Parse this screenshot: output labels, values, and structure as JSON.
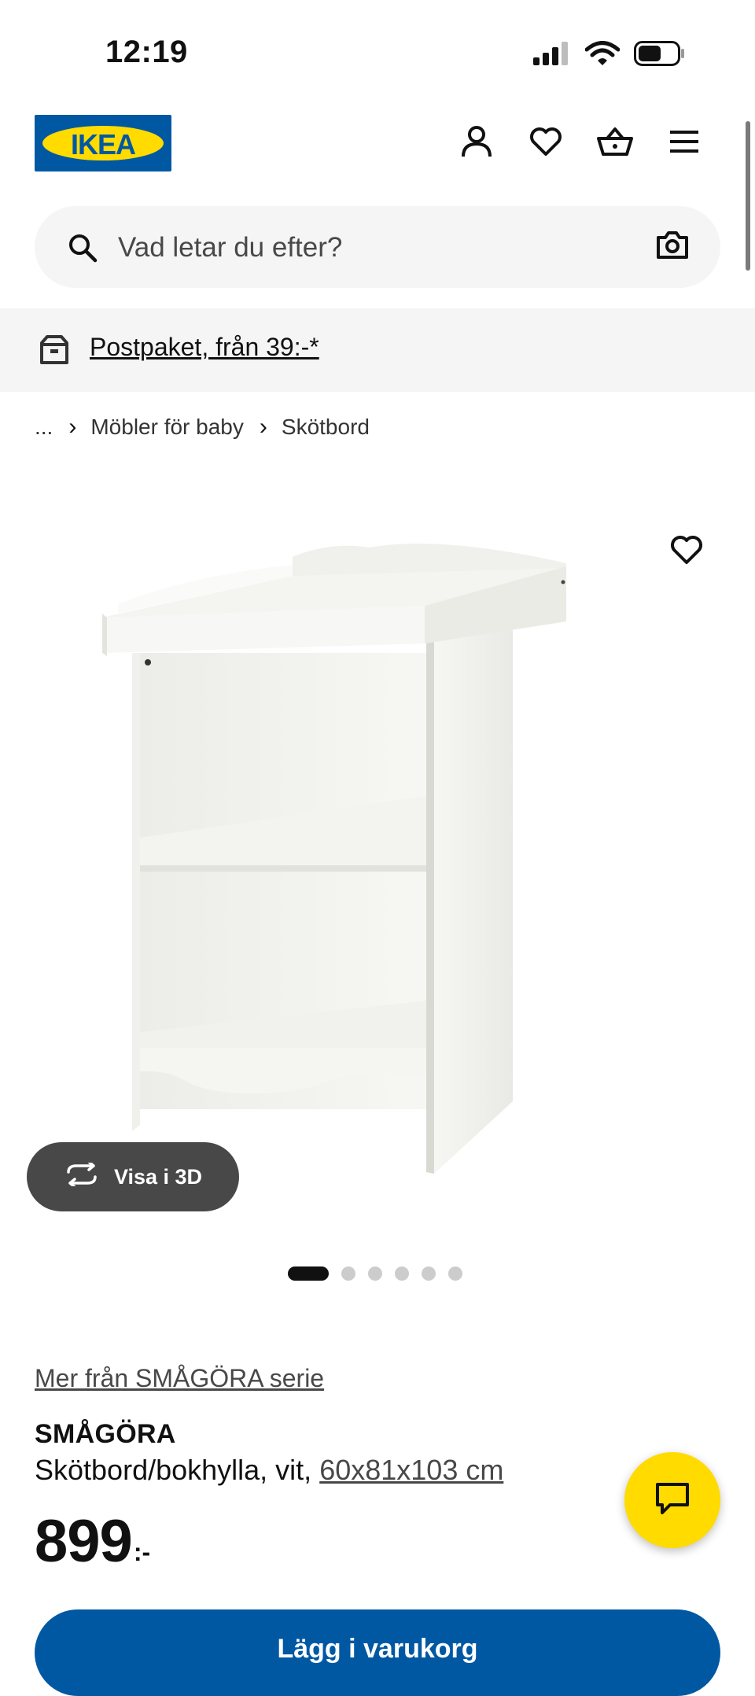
{
  "status_bar": {
    "time": "12:19"
  },
  "header": {
    "logo_text": "IKEA"
  },
  "search": {
    "placeholder": "Vad letar du efter?"
  },
  "banner": {
    "link_text": "Postpaket, från 39:-*"
  },
  "breadcrumb": {
    "ellipsis": "...",
    "items": [
      "Möbler för baby",
      "Skötbord"
    ]
  },
  "gallery": {
    "view_3d_label": "Visa i 3D",
    "total_images": 6,
    "active_index": 0
  },
  "product": {
    "series_link": "Mer från SMÅGÖRA serie",
    "name": "SMÅGÖRA",
    "description": "Skötbord/bokhylla, vit,",
    "dimensions": "60x81x103 cm",
    "price_integer": "899",
    "price_suffix": ":-"
  },
  "cta": {
    "label": "Lägg i varukorg"
  },
  "colors": {
    "ikea_blue": "#0058a3",
    "ikea_yellow": "#ffdb00",
    "dark_gray": "#484848",
    "light_gray": "#f5f5f5"
  }
}
